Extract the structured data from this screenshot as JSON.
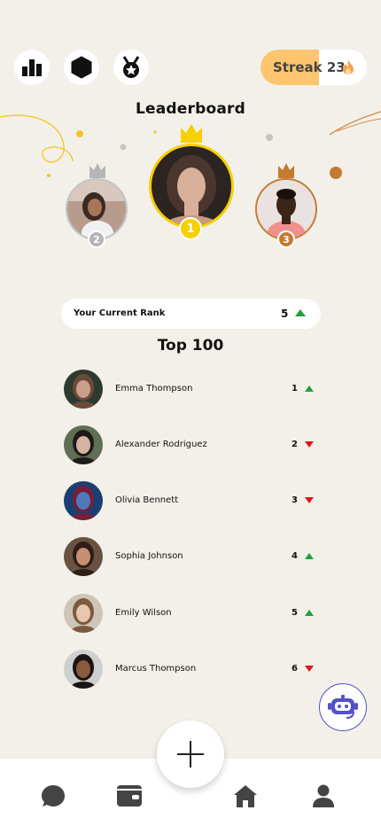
{
  "header": {
    "title": "Leaderboard",
    "streak_label": "Streak 23",
    "icons": [
      "podium-icon",
      "hexagon-icon",
      "medal-icon",
      "flame-icon"
    ]
  },
  "podium": [
    {
      "place": "1",
      "badge_color": "#f7d000",
      "ring_color": "#f7d000",
      "crown_color": "#f7d000"
    },
    {
      "place": "2",
      "badge_color": "#b5b5b5",
      "ring_color": "#c4c4c4",
      "crown_color": "#b5b5b5"
    },
    {
      "place": "3",
      "badge_color": "#c47a31",
      "ring_color": "#c47a31",
      "crown_color": "#c47a31"
    }
  ],
  "current_rank": {
    "label": "Your Current Rank",
    "value": "5",
    "trend": "up"
  },
  "section_title": "Top 100",
  "leaderboard": [
    {
      "name": "Emma Thompson",
      "rank": "1",
      "trend": "up"
    },
    {
      "name": "Alexander Rodriguez",
      "rank": "2",
      "trend": "down"
    },
    {
      "name": "Olivia Bennett",
      "rank": "3",
      "trend": "down"
    },
    {
      "name": "Sophia Johnson",
      "rank": "4",
      "trend": "up"
    },
    {
      "name": "Emily Wilson",
      "rank": "5",
      "trend": "up"
    },
    {
      "name": "Marcus Thompson",
      "rank": "6",
      "trend": "down"
    }
  ],
  "colors": {
    "up": "#1fa13a",
    "down": "#e0141c",
    "accent": "#fcc56e",
    "bot_border": "#5151c9"
  },
  "nav": [
    "chat-icon",
    "wallet-icon",
    "add-icon",
    "home-icon",
    "profile-icon"
  ]
}
